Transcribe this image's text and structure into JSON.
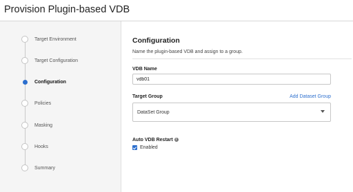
{
  "page": {
    "title": "Provision Plugin-based VDB"
  },
  "steps": [
    {
      "label": "Target Environment",
      "active": false
    },
    {
      "label": "Target Configuration",
      "active": false
    },
    {
      "label": "Configuration",
      "active": true
    },
    {
      "label": "Policies",
      "active": false
    },
    {
      "label": "Masking",
      "active": false
    },
    {
      "label": "Hooks",
      "active": false
    },
    {
      "label": "Summary",
      "active": false
    }
  ],
  "configuration": {
    "title": "Configuration",
    "description": "Name the plugin-based VDB and assign to a group.",
    "vdb_name_label": "VDB Name",
    "vdb_name_value": "vdb01",
    "target_group_label": "Target Group",
    "add_dataset_group_link": "Add Dataset Group",
    "target_group_selected": "DataSet Group",
    "auto_restart_label": "Auto VDB Restart",
    "auto_restart_info_icon": "i",
    "auto_restart_enabled": true,
    "enabled_label": "Enabled"
  },
  "colors": {
    "accent": "#2c6fce",
    "sidebar_bg": "#f5f5f5"
  },
  "icons": {
    "step_marker": "circle-icon",
    "info": "info-icon",
    "dropdown": "caret-down-icon",
    "checkbox": "checkbox-checked-icon"
  }
}
